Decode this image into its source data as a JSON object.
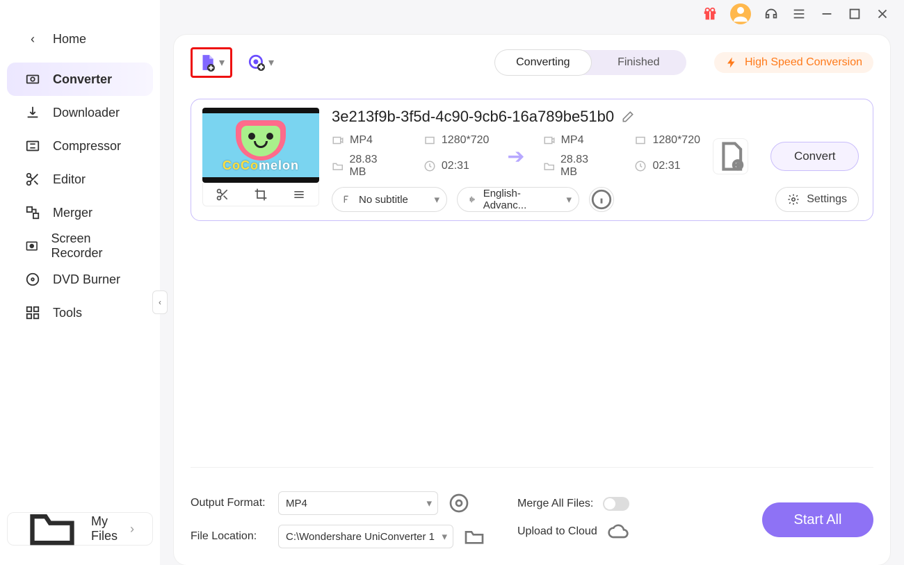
{
  "sidebar": {
    "home": "Home",
    "items": [
      {
        "label": "Converter"
      },
      {
        "label": "Downloader"
      },
      {
        "label": "Compressor"
      },
      {
        "label": "Editor"
      },
      {
        "label": "Merger"
      },
      {
        "label": "Screen Recorder"
      },
      {
        "label": "DVD Burner"
      },
      {
        "label": "Tools"
      }
    ],
    "myfiles": "My Files"
  },
  "tabs": {
    "converting": "Converting",
    "finished": "Finished"
  },
  "hsc": "High Speed Conversion",
  "file": {
    "name": "3e213f9b-3f5d-4c90-9cb6-16a789be51b0",
    "thumb_brand_a": "CoCo",
    "thumb_brand_b": "melon",
    "src": {
      "format": "MP4",
      "resolution": "1280*720",
      "size": "28.83 MB",
      "duration": "02:31"
    },
    "dst": {
      "format": "MP4",
      "resolution": "1280*720",
      "size": "28.83 MB",
      "duration": "02:31"
    },
    "subtitle": "No subtitle",
    "audio": "English-Advanc...",
    "settings": "Settings",
    "convert": "Convert"
  },
  "bottom": {
    "output_format_label": "Output Format:",
    "output_format_value": "MP4",
    "file_location_label": "File Location:",
    "file_location_value": "C:\\Wondershare UniConverter 1",
    "merge_label": "Merge All Files:",
    "upload_label": "Upload to Cloud",
    "start_all": "Start All"
  }
}
